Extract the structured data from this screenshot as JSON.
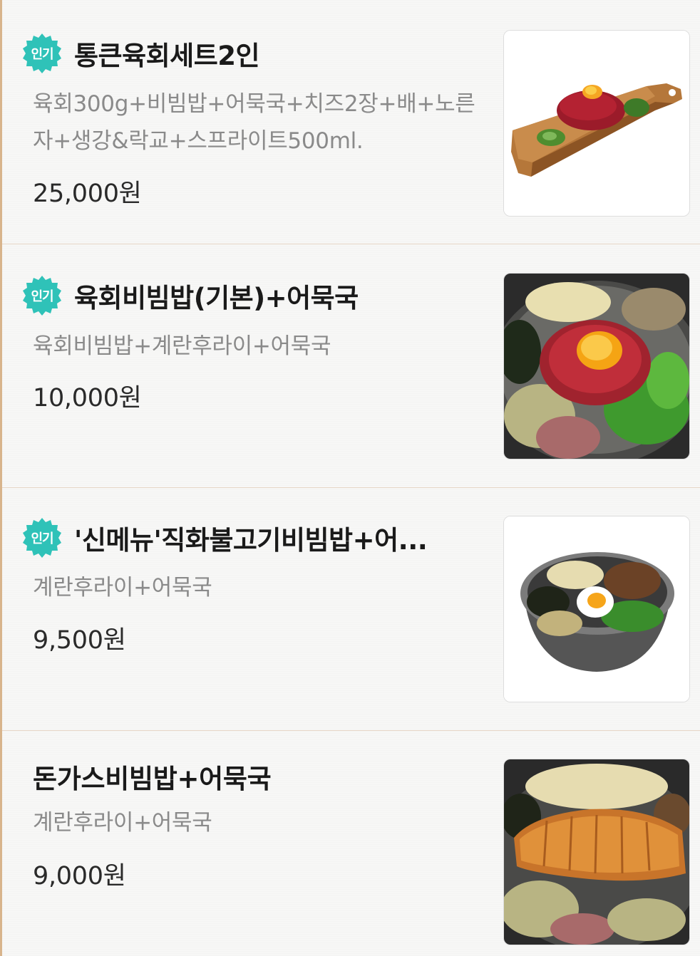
{
  "menu": {
    "items": [
      {
        "badge": "인기",
        "name": "통큰육회세트2인",
        "description": "육회300g+비빔밥+어묵국+치즈2장+배+노른자+생강&락교+스프라이트500ml.",
        "price": "25,000원",
        "image_icon": "beef-tartare-board-photo"
      },
      {
        "badge": "인기",
        "name": "육회비빔밥(기본)+어묵국",
        "description": "육회비빔밥+계란후라이+어묵국",
        "price": "10,000원",
        "image_icon": "beef-tartare-bibimbap-photo"
      },
      {
        "badge": "인기",
        "name": "'신메뉴'직화불고기비빔밥+어...",
        "description": "계란후라이+어묵국",
        "price": "9,500원",
        "image_icon": "bulgogi-bibimbap-photo"
      },
      {
        "name": "돈가스비빔밥+어묵국",
        "description": "계란후라이+어묵국",
        "price": "9,000원",
        "image_icon": "pork-cutlet-bibimbap-photo"
      }
    ]
  },
  "colors": {
    "badge": "#2fc2b8",
    "divider": "#e6d6c6",
    "left_accent": "#d8b48c"
  }
}
